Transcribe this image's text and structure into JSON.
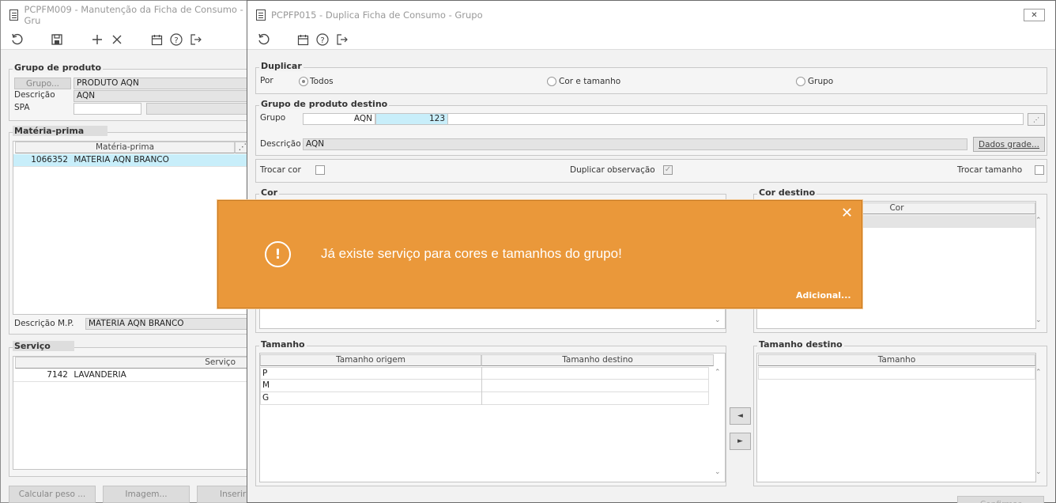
{
  "bg_window": {
    "title": "PCPFM009 - Manutenção da Ficha de Consumo - Gru",
    "grupo_produto": {
      "title": "Grupo de produto",
      "grupo_button": "Grupo...",
      "grupo_value": "PRODUTO AQN",
      "descricao_label": "Descrição",
      "descricao_value": "AQN",
      "spa_label": "SPA"
    },
    "materia_prima": {
      "title": "Matéria-prima",
      "column": "Matéria-prima",
      "rows": [
        {
          "code": "1066352",
          "name": "MATERIA AQN BRANCO"
        }
      ],
      "descricao_label": "Descrição M.P.",
      "descricao_value": "MATERIA AQN BRANCO"
    },
    "servico": {
      "title": "Serviço",
      "column": "Serviço",
      "rows": [
        {
          "code": "7142",
          "name": "LAVANDERIA"
        }
      ]
    },
    "buttons": {
      "calcular": "Calcular peso ...",
      "imagem": "Imagem...",
      "inserir": "Inserir I"
    }
  },
  "fg_window": {
    "title": "PCPFP015 - Duplica Ficha de Consumo - Grupo",
    "close_label": "✕",
    "duplicar": {
      "title": "Duplicar",
      "por_label": "Por",
      "options": [
        "Todos",
        "Cor e tamanho",
        "Grupo"
      ],
      "selected": "Todos"
    },
    "destino": {
      "title": "Grupo de produto destino",
      "grupo_label": "Grupo",
      "grupo_code": "AQN",
      "grupo_number": "123",
      "descricao_label": "Descrição",
      "descricao_value": "AQN",
      "dados_grade_button": "Dados grade..."
    },
    "options": {
      "trocar_cor": "Trocar cor",
      "trocar_cor_checked": false,
      "duplicar_obs": "Duplicar observação",
      "duplicar_obs_checked": true,
      "trocar_tamanho": "Trocar tamanho",
      "trocar_tamanho_checked": false
    },
    "cor": {
      "title": "Cor"
    },
    "cor_destino": {
      "title": "Cor destino",
      "column": "Cor"
    },
    "tamanho": {
      "title": "Tamanho",
      "col_origem": "Tamanho origem",
      "col_destino": "Tamanho destino",
      "rows": [
        "P",
        "M",
        "G"
      ]
    },
    "tamanho_destino": {
      "title": "Tamanho destino",
      "column": "Tamanho"
    },
    "arrow_left": "◄",
    "arrow_right": "►",
    "confirm_button": "Confirmar"
  },
  "toast": {
    "message": "Já existe serviço para cores e tamanhos do grupo!",
    "close": "✕",
    "icon": "!",
    "link": "Adicional...",
    "color": "#ea983a"
  }
}
